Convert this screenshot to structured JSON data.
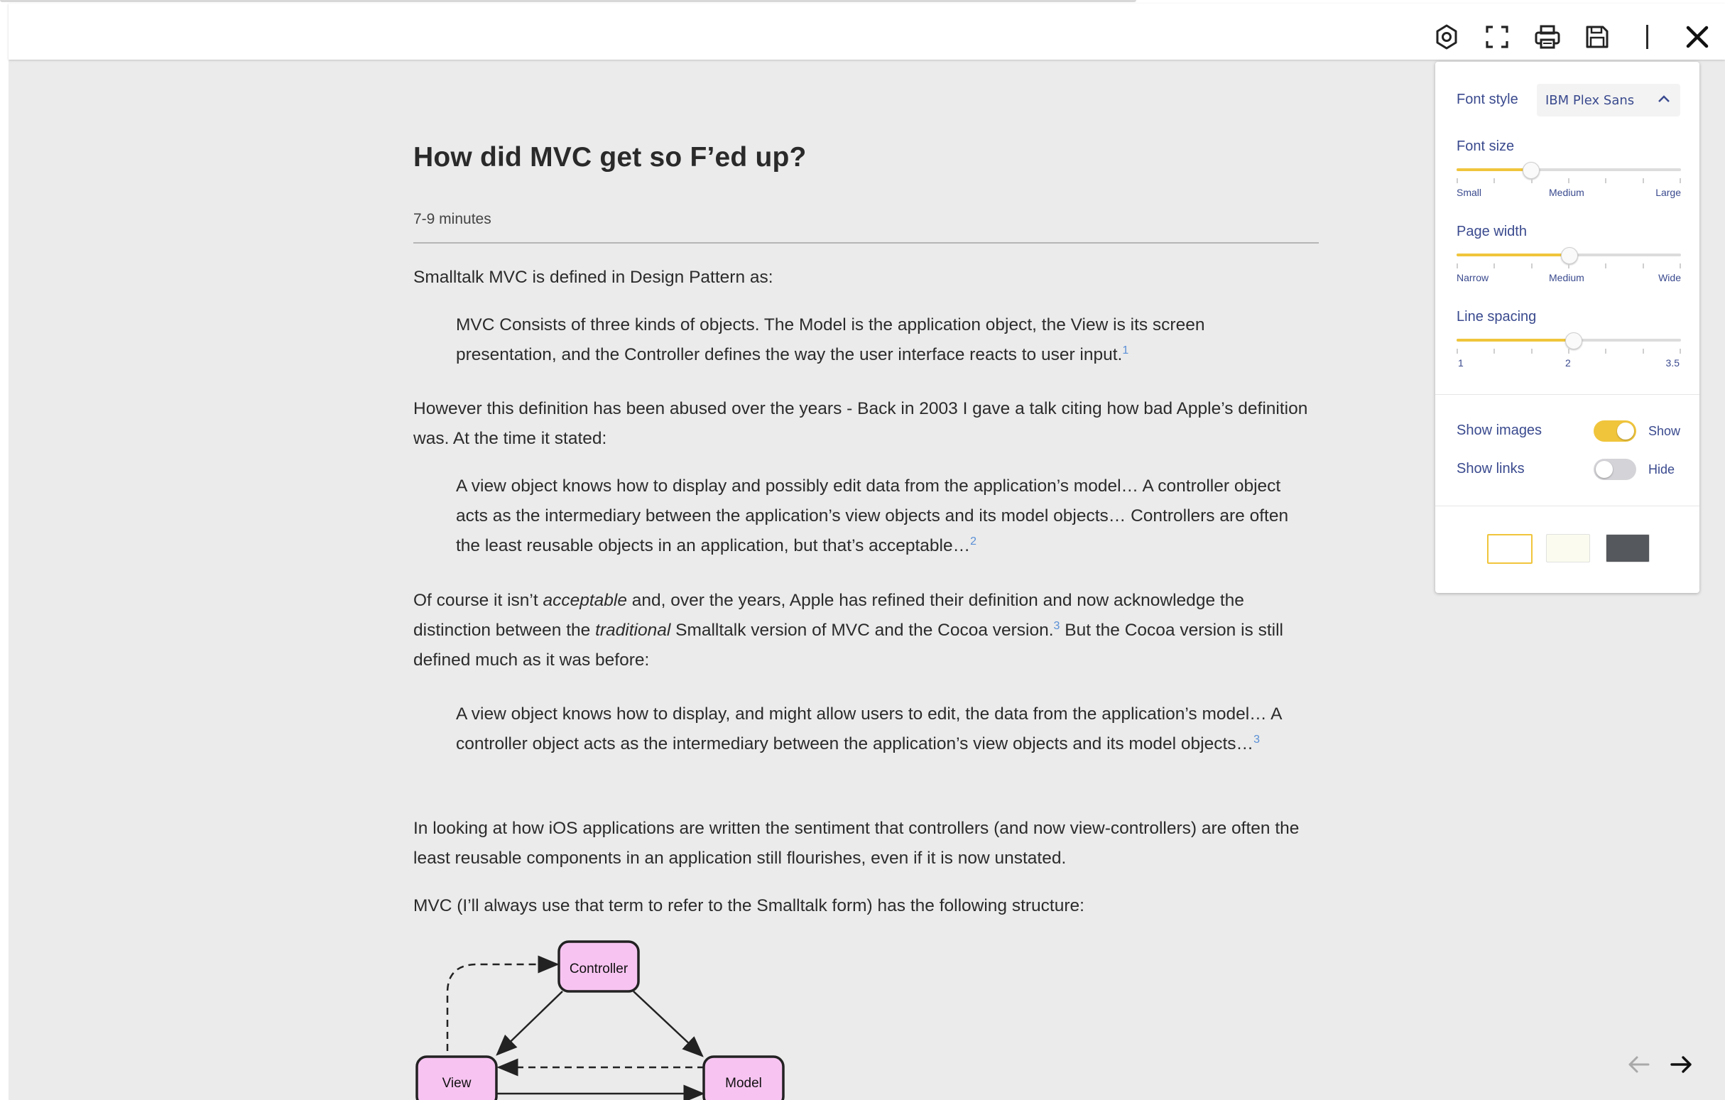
{
  "article": {
    "title": "How did MVC get so F’ed up?",
    "read_time": "7-9 minutes",
    "p1": "Smalltalk MVC is defined in Design Pattern as:",
    "q1": "MVC Consists of three kinds of objects. The Model is the application object, the View is its screen presentation, and the Controller defines the way the user interface reacts to user input.",
    "q1_ref": "1",
    "p2": "However this definition has been abused over the years - Back in 2003 I gave a talk citing how bad Apple’s definition was. At the time it stated:",
    "q2": "A view object knows how to display and possibly edit data from the application’s model… A controller object acts as the intermediary between the application’s view objects and its model objects… Controllers are often the least reusable objects in an application, but that’s acceptable…",
    "q2_ref": "2",
    "p3_a": "Of course it isn’t ",
    "p3_em1": "acceptable",
    "p3_b": " and, over the years, Apple has refined their definition and now acknowledge the distinction between the ",
    "p3_em2": "traditional",
    "p3_c": " Smalltalk version of MVC and the Cocoa version.",
    "p3_ref": "3",
    "p3_d": " But the Cocoa version is still defined much as it was before:",
    "q3": "A view object knows how to display, and might allow users to edit, the data from the application’s model… A controller object acts as the intermediary between the application’s view objects and its model objects…",
    "q3_ref": "3",
    "p4": "In looking at how iOS applications are written the sentiment that controllers (and now view-controllers) are often the least reusable components in an application still flourishes, even if it is now unstated.",
    "p5": "MVC (I’ll always use that term to refer to the Smalltalk form) has the following structure:",
    "diagram": {
      "controller": "Controller",
      "view": "View",
      "model": "Model"
    }
  },
  "toolbar": {
    "icons": [
      "settings-icon",
      "fullscreen-icon",
      "print-icon",
      "save-icon",
      "close-icon"
    ]
  },
  "settings": {
    "font_style_label": "Font style",
    "font_style_value": "IBM Plex Sans",
    "font_size_label": "Font size",
    "font_size_level": 0.33,
    "font_size_ticks": [
      "Small",
      "Medium",
      "Large"
    ],
    "page_width_label": "Page width",
    "page_width_level": 0.5,
    "page_width_ticks": [
      "Narrow",
      "Medium",
      "Wide"
    ],
    "line_spacing_label": "Line spacing",
    "line_spacing_level": 0.52,
    "line_spacing_ticks": [
      "1",
      "2",
      "3.5"
    ],
    "show_images_label": "Show images",
    "show_images_state": "Show",
    "show_images_on": true,
    "show_links_label": "Show links",
    "show_links_state": "Hide",
    "show_links_on": false,
    "themes": [
      "#ffffff",
      "#fbfcef",
      "#55585c"
    ],
    "accent": "#f0c53c"
  }
}
